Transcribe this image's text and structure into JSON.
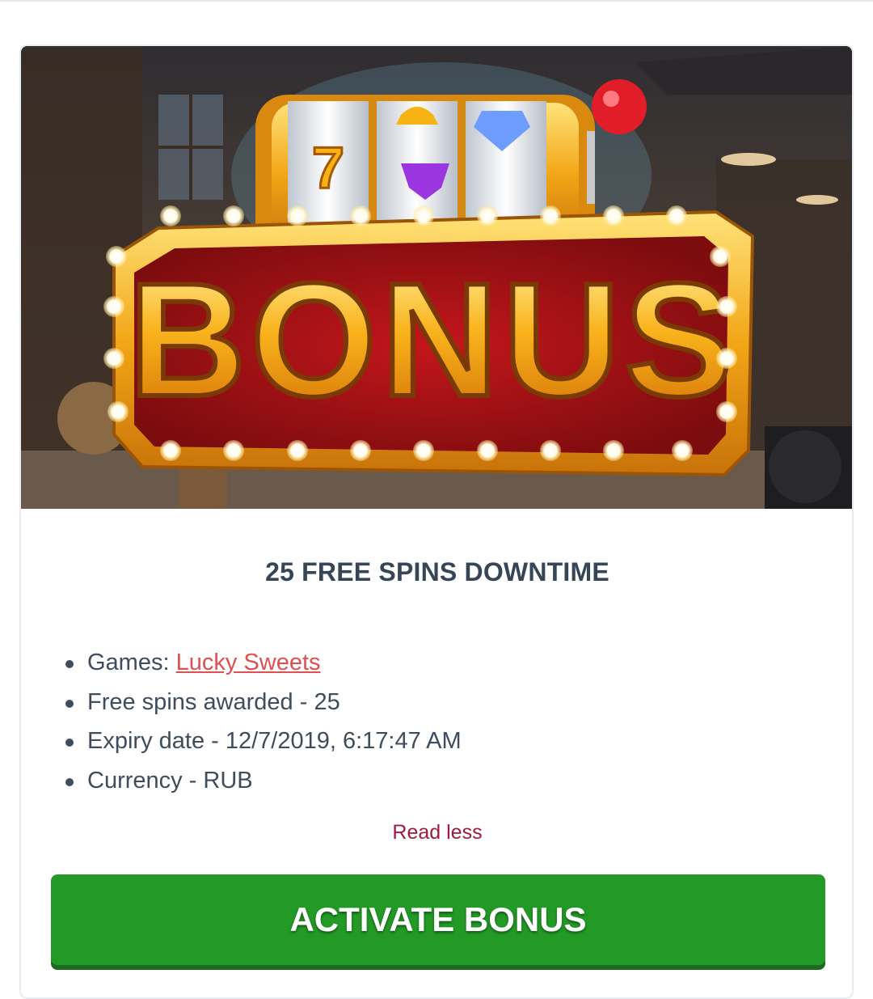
{
  "banner": {
    "headline": "BONUS",
    "reel_symbols": [
      "7",
      "bell",
      "diamond"
    ]
  },
  "bonus": {
    "title": "25 FREE SPINS DOWNTIME",
    "details": {
      "games_label": "Games:",
      "games_link": "Lucky Sweets",
      "free_spins": "Free spins awarded - 25",
      "expiry": "Expiry date - 12/7/2019, 6:17:47 AM",
      "currency": "Currency - RUB"
    },
    "read_less": "Read less",
    "activate_label": "ACTIVATE BONUS"
  },
  "colors": {
    "title": "#364657",
    "link": "#e05050",
    "read_less": "#a01a40",
    "button": "#239a26"
  }
}
